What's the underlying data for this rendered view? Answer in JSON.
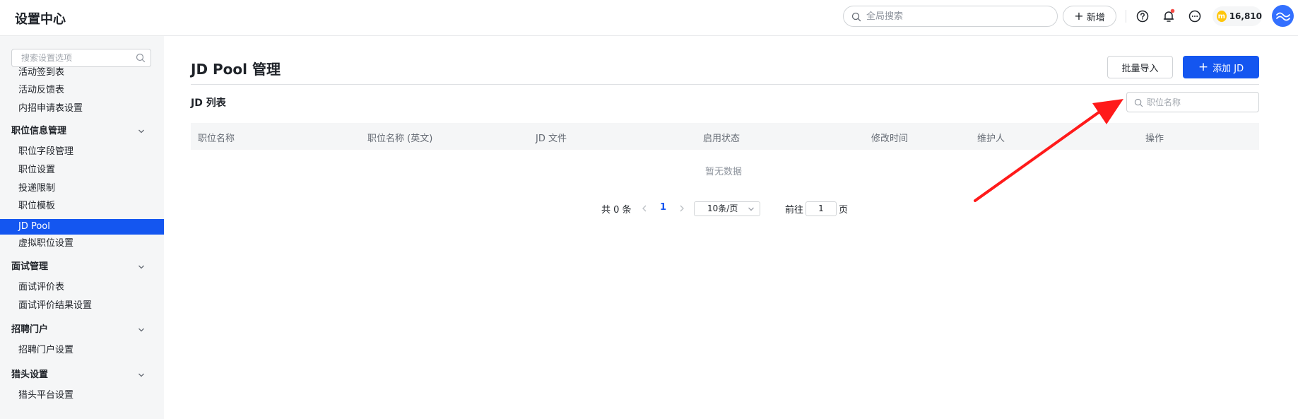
{
  "header": {
    "app_title": "设置中心",
    "search_placeholder": "全局搜索",
    "new_label": "新增",
    "coin_count": "16,810",
    "coin_symbol": "m"
  },
  "sidebar": {
    "search_placeholder": "搜索设置选项",
    "items": [
      {
        "label": "活动签到表",
        "type": "item"
      },
      {
        "label": "活动反馈表",
        "type": "item"
      },
      {
        "label": "内招申请表设置",
        "type": "item"
      },
      {
        "label": "职位信息管理",
        "type": "group"
      },
      {
        "label": "职位字段管理",
        "type": "item"
      },
      {
        "label": "职位设置",
        "type": "item"
      },
      {
        "label": "投递限制",
        "type": "item"
      },
      {
        "label": "职位模板",
        "type": "item"
      },
      {
        "label": "JD Pool",
        "type": "item",
        "active": true
      },
      {
        "label": "虚拟职位设置",
        "type": "item"
      },
      {
        "label": "面试管理",
        "type": "group"
      },
      {
        "label": "面试评价表",
        "type": "item"
      },
      {
        "label": "面试评价结果设置",
        "type": "item"
      },
      {
        "label": "招聘门户",
        "type": "group"
      },
      {
        "label": "招聘门户设置",
        "type": "item"
      },
      {
        "label": "猎头设置",
        "type": "group"
      },
      {
        "label": "猎头平台设置",
        "type": "item"
      }
    ]
  },
  "main": {
    "title": "JD Pool 管理",
    "import_label": "批量导入",
    "add_label": "添加 JD",
    "list_title": "JD 列表",
    "search_placeholder": "职位名称",
    "columns": [
      "职位名称",
      "职位名称 (英文)",
      "JD 文件",
      "启用状态",
      "修改时间",
      "维护人",
      "操作"
    ],
    "empty_text": "暂无数据"
  },
  "pagination": {
    "total_text": "共 0 条",
    "current_page": "1",
    "page_size": "10条/页",
    "goto_label": "前往",
    "goto_value": "1",
    "goto_unit": "页"
  },
  "colors": {
    "accent": "#1456f0",
    "annotation_arrow": "#ff1a1a"
  }
}
